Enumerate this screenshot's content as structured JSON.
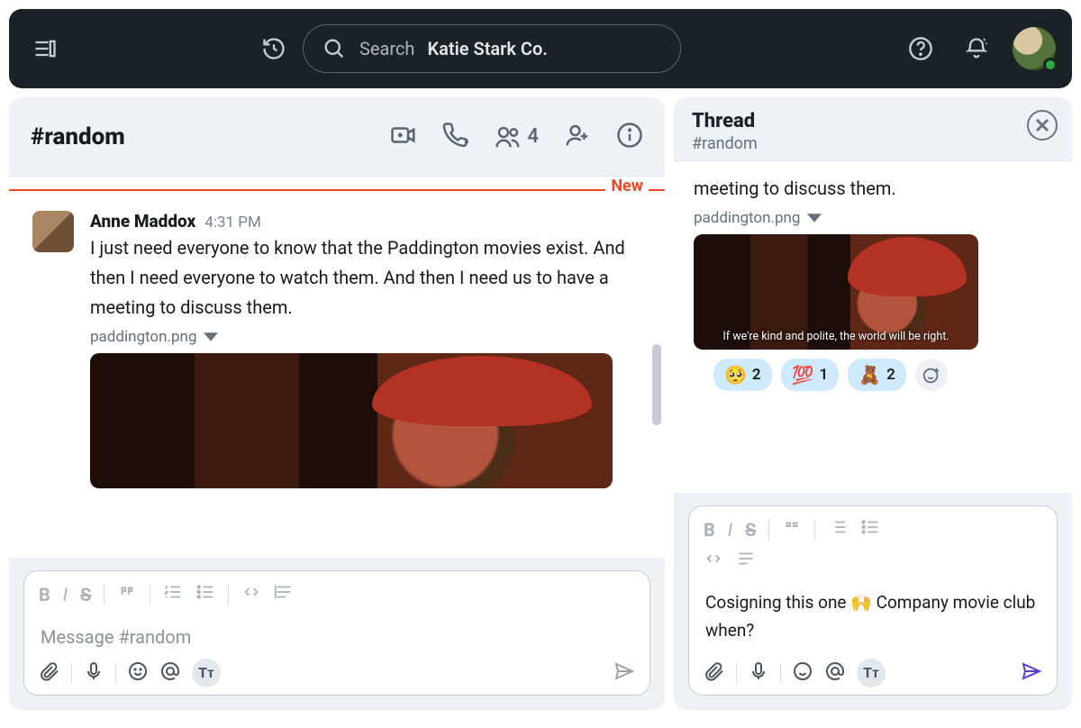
{
  "topbar": {
    "search_prefix": "Search",
    "workspace": "Katie Stark Co."
  },
  "channel": {
    "title": "#random",
    "member_count": "4",
    "new_label": "New"
  },
  "message": {
    "author": "Anne Maddox",
    "time": "4:31 PM",
    "body": "I just need everyone to know that the Paddington movies exist. And then I need everyone to watch them. And then I need us to have a meeting to discuss them.",
    "attachment": "paddington.png"
  },
  "composer": {
    "placeholder": "Message #random"
  },
  "thread": {
    "title": "Thread",
    "subtitle": "#random",
    "snippet": "meeting to discuss them.",
    "attachment": "paddington.png",
    "caption": "If we're kind and polite,\nthe world will be right.",
    "reactions": [
      {
        "emoji": "🥺",
        "count": "2"
      },
      {
        "emoji": "💯",
        "count": "1"
      },
      {
        "emoji": "🧸",
        "count": "2"
      }
    ],
    "reply": "Cosigning this one 🙌 Company movie club when?"
  }
}
